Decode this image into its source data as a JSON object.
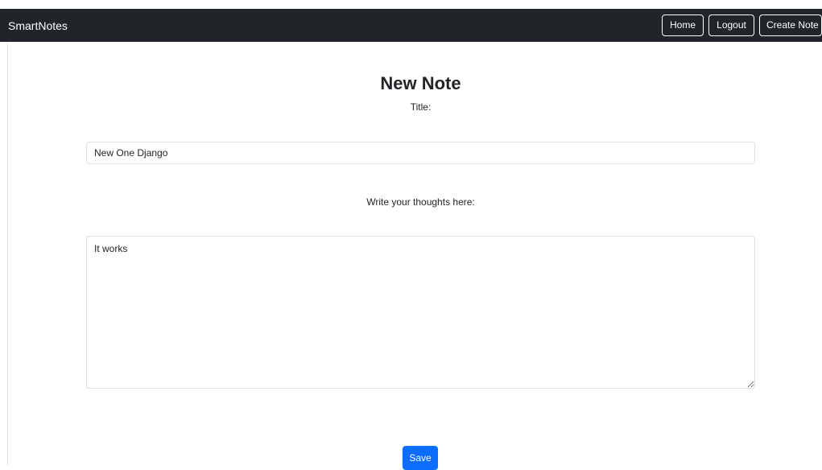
{
  "navbar": {
    "brand": "SmartNotes",
    "links": {
      "home": "Home",
      "logout": "Logout",
      "create_note": "Create Note"
    }
  },
  "form": {
    "heading": "New Note",
    "title_label": "Title:",
    "title_value": "New One Django",
    "body_label": "Write your thoughts here:",
    "body_value": "It works",
    "save_label": "Save"
  },
  "colors": {
    "navbar_bg": "#212529",
    "primary": "#0d6efd"
  }
}
